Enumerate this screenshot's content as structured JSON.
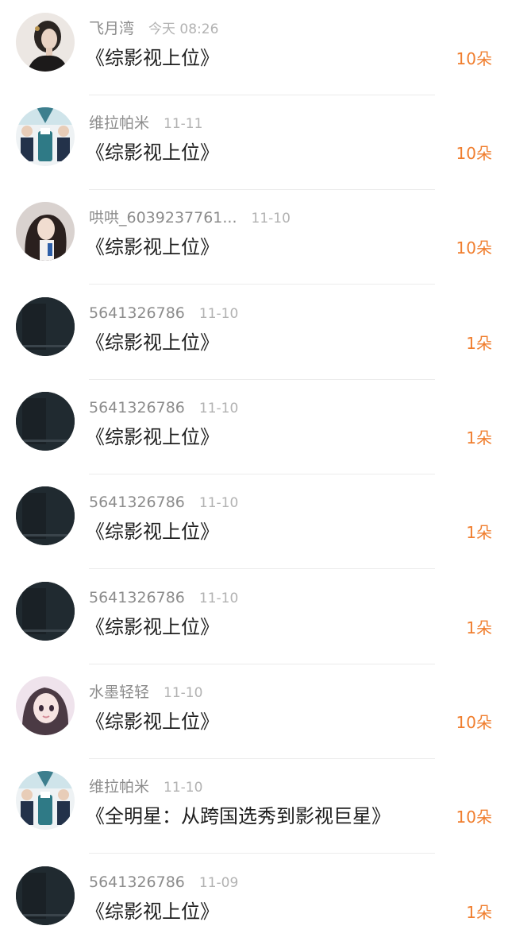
{
  "colors": {
    "gift_accent": "#f07e2e",
    "name_text": "#8c8c8c",
    "time_text": "#b2b2b2",
    "title_text": "#1e1e1e"
  },
  "gifts": [
    {
      "avatar": "woman-dark-hair-avatar",
      "name": "飞月湾",
      "time": "今天 08:26",
      "title": "《综影视上位》",
      "amount": "10朵"
    },
    {
      "avatar": "group-photo-avatar",
      "name": "维拉帕米",
      "time": "11-11",
      "title": "《综影视上位》",
      "amount": "10朵"
    },
    {
      "avatar": "girl-long-hair-avatar",
      "name": "哄哄_6039237761...",
      "time": "11-10",
      "title": "《综影视上位》",
      "amount": "10朵"
    },
    {
      "avatar": "dark-avatar",
      "name": "5641326786",
      "time": "11-10",
      "title": "《综影视上位》",
      "amount": "1朵"
    },
    {
      "avatar": "dark-avatar",
      "name": "5641326786",
      "time": "11-10",
      "title": "《综影视上位》",
      "amount": "1朵"
    },
    {
      "avatar": "dark-avatar",
      "name": "5641326786",
      "time": "11-10",
      "title": "《综影视上位》",
      "amount": "1朵"
    },
    {
      "avatar": "dark-avatar",
      "name": "5641326786",
      "time": "11-10",
      "title": "《综影视上位》",
      "amount": "1朵"
    },
    {
      "avatar": "anime-girl-avatar",
      "name": "水墨轻轻",
      "time": "11-10",
      "title": "《综影视上位》",
      "amount": "10朵"
    },
    {
      "avatar": "group-photo-avatar",
      "name": "维拉帕米",
      "time": "11-10",
      "title": "《全明星：从跨国选秀到影视巨星》",
      "amount": "10朵"
    },
    {
      "avatar": "dark-avatar",
      "name": "5641326786",
      "time": "11-09",
      "title": "《综影视上位》",
      "amount": "1朵"
    }
  ]
}
